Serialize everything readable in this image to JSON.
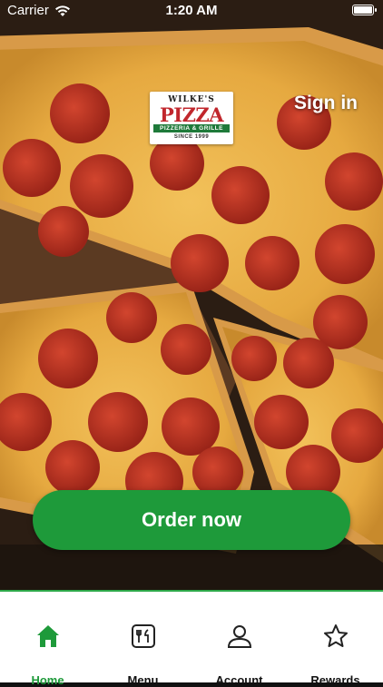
{
  "status_bar": {
    "carrier": "Carrier",
    "time": "1:20 AM"
  },
  "header": {
    "logo": {
      "line1": "WILKE'S",
      "line2": "PIZZA",
      "line3": "PIZZERIA & GRILLE",
      "line4": "SINCE 1999"
    },
    "sign_in_label": "Sign in"
  },
  "main": {
    "order_button_label": "Order now"
  },
  "tabbar": {
    "active": "home",
    "items": [
      {
        "id": "home",
        "label": "Home",
        "icon": "home-icon"
      },
      {
        "id": "menu",
        "label": "Menu",
        "icon": "menu-icon"
      },
      {
        "id": "account",
        "label": "Account",
        "icon": "account-icon"
      },
      {
        "id": "rewards",
        "label": "Rewards",
        "icon": "star-icon"
      }
    ]
  },
  "colors": {
    "accent": "#1e9a3a",
    "tab_border": "#2ea84a",
    "logo_red": "#c1272d"
  }
}
